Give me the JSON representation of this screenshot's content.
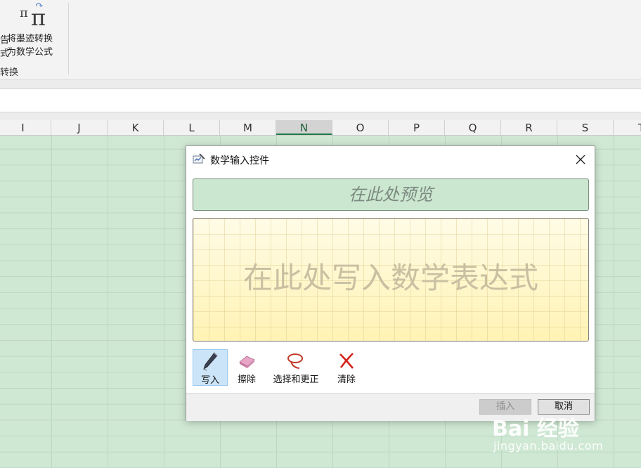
{
  "ribbon": {
    "convert_button": {
      "icon": "pi-convert-icon",
      "label_line1": "将墨迹转换",
      "label_line2": "为数学公式"
    },
    "cut_label_line1": "告",
    "cut_label_line2": "式",
    "group_label": "转换"
  },
  "columns": [
    {
      "label": "I"
    },
    {
      "label": "J"
    },
    {
      "label": "K"
    },
    {
      "label": "L"
    },
    {
      "label": "M"
    },
    {
      "label": "N",
      "selected": true
    },
    {
      "label": "O"
    },
    {
      "label": "P"
    },
    {
      "label": "Q"
    },
    {
      "label": "R"
    },
    {
      "label": "S"
    },
    {
      "label": "T"
    }
  ],
  "dialog": {
    "title": "数学输入控件",
    "title_icon": "math-input-icon",
    "close_icon": "close-icon",
    "preview_placeholder": "在此处预览",
    "write_placeholder": "在此处写入数学表达式",
    "tools": [
      {
        "id": "write",
        "label": "写入",
        "icon": "pen-icon",
        "active": true
      },
      {
        "id": "erase",
        "label": "擦除",
        "icon": "eraser-icon",
        "active": false
      },
      {
        "id": "select",
        "label": "选择和更正",
        "icon": "lasso-icon",
        "active": false
      },
      {
        "id": "clear",
        "label": "清除",
        "icon": "clear-x-icon",
        "active": false
      }
    ],
    "insert_label": "插入",
    "cancel_label": "取消"
  },
  "watermark": {
    "logo": "Bai 经验",
    "url": "jingyan.baidu.com"
  },
  "colors": {
    "grid_background": "#cfe8d3",
    "preview_background": "#cbe7d0",
    "write_area_background": "#fff7c8",
    "active_tool": "#cce4f7",
    "selected_column_accent": "#1d7a45"
  }
}
